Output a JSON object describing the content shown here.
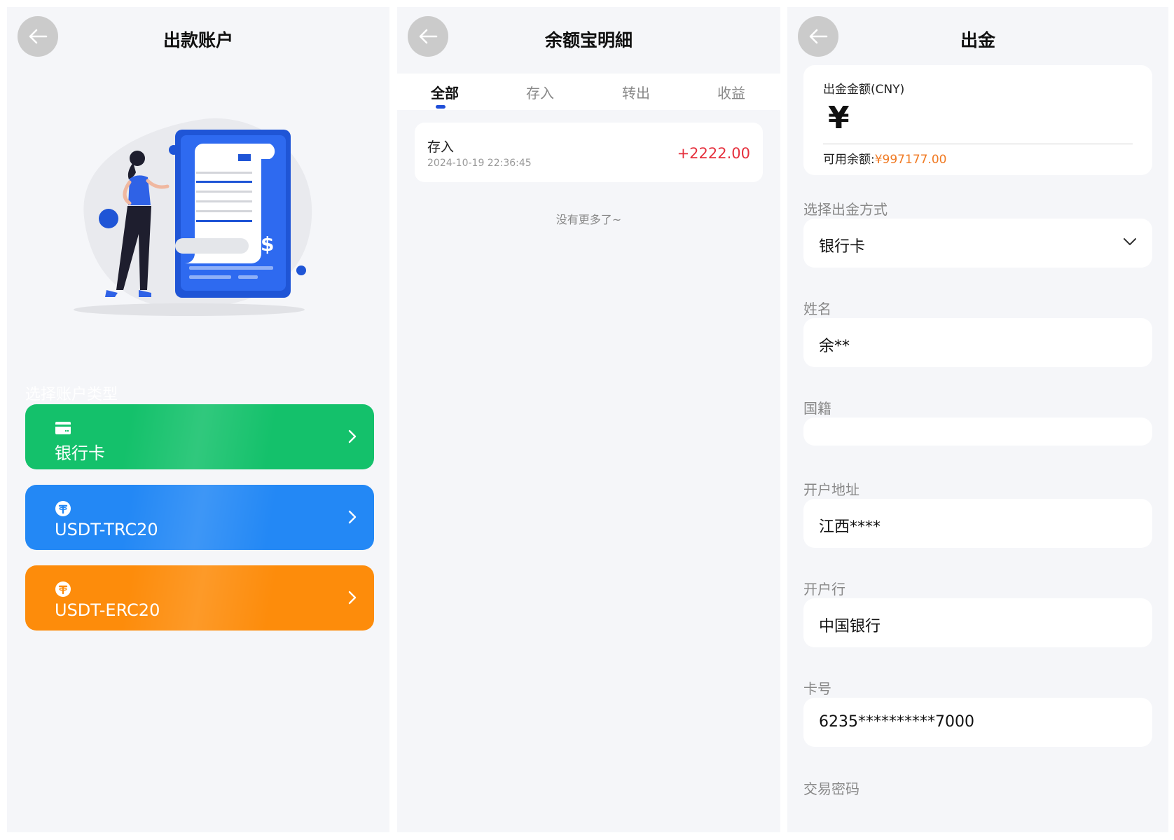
{
  "panel1": {
    "title": "出款账户",
    "section_label": "选择账户类型",
    "accounts": [
      {
        "label": "银行卡",
        "icon": "card-icon",
        "color": "#14c16b"
      },
      {
        "label": "USDT-TRC20",
        "icon": "tether-icon",
        "color": "#2388f5"
      },
      {
        "label": "USDT-ERC20",
        "icon": "tether-icon",
        "color": "#fd8c0b"
      }
    ]
  },
  "panel2": {
    "title": "余额宝明細",
    "tabs": [
      {
        "label": "全部",
        "active": true
      },
      {
        "label": "存入",
        "active": false
      },
      {
        "label": "转出",
        "active": false
      },
      {
        "label": "收益",
        "active": false
      }
    ],
    "records": [
      {
        "type": "存入",
        "time": "2024-10-19 22:36:45",
        "amount": "+2222.00"
      }
    ],
    "no_more": "没有更多了~"
  },
  "panel3": {
    "title": "出金",
    "amount_label": "出金金额(CNY)",
    "currency_symbol": "¥",
    "amount_value": "",
    "available_label": "可用余额:",
    "available_value": "¥997177.00",
    "method_label": "选择出金方式",
    "method_value": "银行卡",
    "fields": [
      {
        "label": "姓名",
        "value": "余**"
      },
      {
        "label": "国籍",
        "value": ""
      },
      {
        "label": "开户地址",
        "value": "江西****"
      },
      {
        "label": "开户行",
        "value": "中国银行"
      },
      {
        "label": "卡号",
        "value": "6235**********7000"
      }
    ],
    "next_label": "交易密码"
  },
  "colors": {
    "accent_blue": "#1f4ed8",
    "positive_red": "#e5303d",
    "balance_orange": "#f07a23"
  }
}
